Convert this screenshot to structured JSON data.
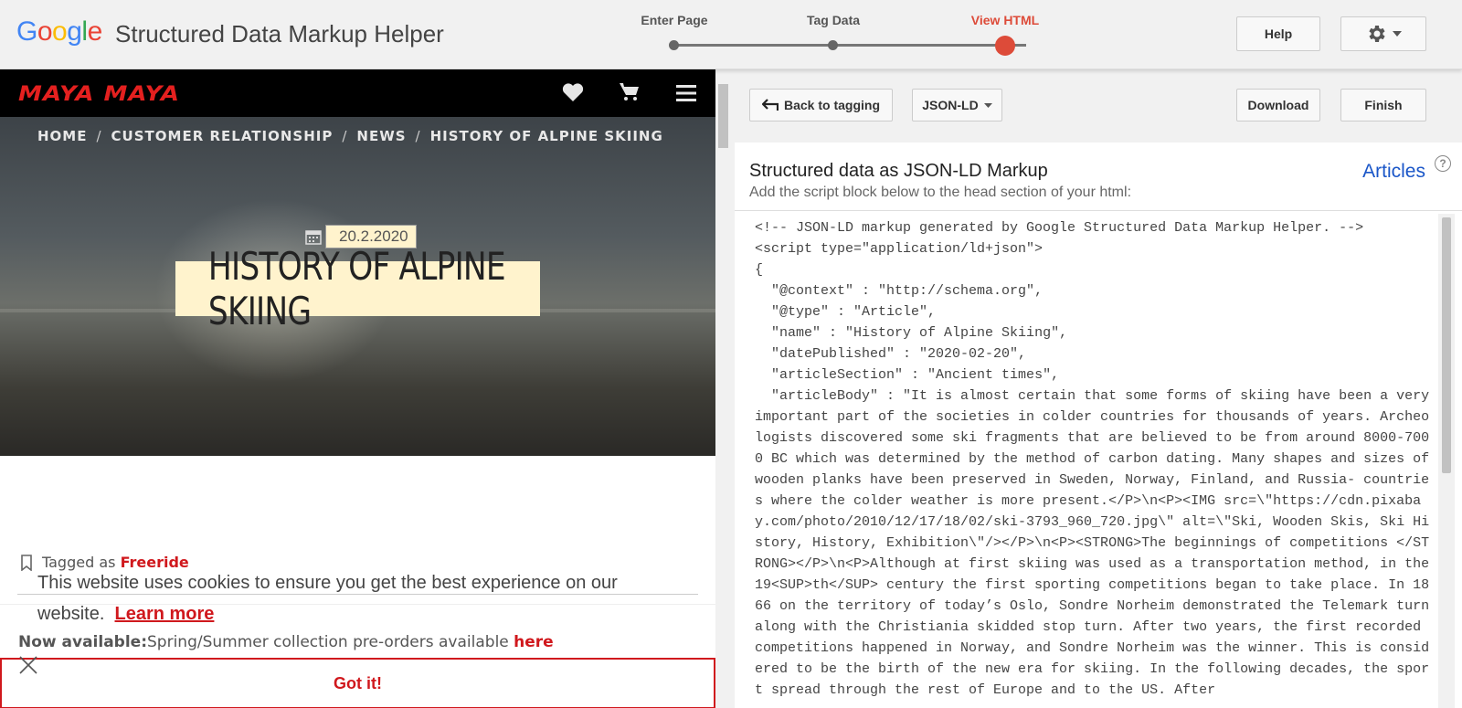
{
  "header": {
    "logo_text": "Google",
    "app_title": "Structured Data Markup Helper",
    "steps": [
      "Enter Page",
      "Tag Data",
      "View HTML"
    ],
    "active_step": 2,
    "help_label": "Help"
  },
  "site": {
    "logo": "MAYA MAYA",
    "breadcrumbs": [
      "HOME",
      "CUSTOMER RELATIONSHIP",
      "NEWS",
      "HISTORY OF ALPINE SKIING"
    ],
    "date": "20.2.2020",
    "headline": "HISTORY OF ALPINE SKIING",
    "tagged_prefix": "Tagged as",
    "tag": "Freeride",
    "cookie_text": "This website uses cookies to ensure you get the best experience on our website.",
    "cookie_link": "Learn more",
    "available_label": "Now available:",
    "available_text": "Spring/Summer collection pre-orders available",
    "available_link": "here",
    "got_it": "Got it!"
  },
  "right": {
    "back_label": "Back to tagging",
    "format_label": "JSON-LD",
    "download_label": "Download",
    "finish_label": "Finish",
    "title": "Structured data as JSON-LD Markup",
    "subtitle": "Add the script block below to the head section of your html:",
    "schema_type": "Articles",
    "help_glyph": "?",
    "code": "<!-- JSON-LD markup generated by Google Structured Data Markup Helper. -->\n<script type=\"application/ld+json\">\n{\n  \"@context\" : \"http://schema.org\",\n  \"@type\" : \"Article\",\n  \"name\" : \"History of Alpine Skiing\",\n  \"datePublished\" : \"2020-02-20\",\n  \"articleSection\" : \"Ancient times\",\n  \"articleBody\" : \"It is almost certain that some forms of skiing have been a very important part of the societies in colder countries for thousands of years. Archeologists discovered some ski fragments that are believed to be from around 8000-7000 BC which was determined by the method of carbon dating. Many shapes and sizes of wooden planks have been preserved in Sweden, Norway, Finland, and Russia- countries where the colder weather is more present.</P>\\n<P><IMG src=\\\"https://cdn.pixabay.com/photo/2010/12/17/18/02/ski-3793_960_720.jpg\\\" alt=\\\"Ski, Wooden Skis, Ski History, History, Exhibition\\\"/></P>\\n<P><STRONG>The beginnings of competitions </STRONG></P>\\n<P>Although at first skiing was used as a transportation method, in the 19<SUP>th</SUP> century the first sporting competitions began to take place. In 1866 on the territory of today’s Oslo, Sondre Norheim demonstrated the Telemark turn along with the Christiania skidded stop turn. After two years, the first recorded competitions happened in Norway, and Sondre Norheim was the winner. This is considered to be the birth of the new era for skiing. In the following decades, the sport spread through the rest of Europe and to the US. After"
  },
  "colors": {
    "accent": "#dd4b39",
    "brand_red": "#d0181d",
    "link_blue": "#1a56c8",
    "highlight": "#fff3cd"
  },
  "icons": [
    "heart-icon",
    "cart-icon",
    "menu-icon",
    "calendar-icon",
    "tag-icon",
    "close-icon",
    "gear-icon",
    "back-arrow-icon",
    "chevron-down-icon"
  ]
}
